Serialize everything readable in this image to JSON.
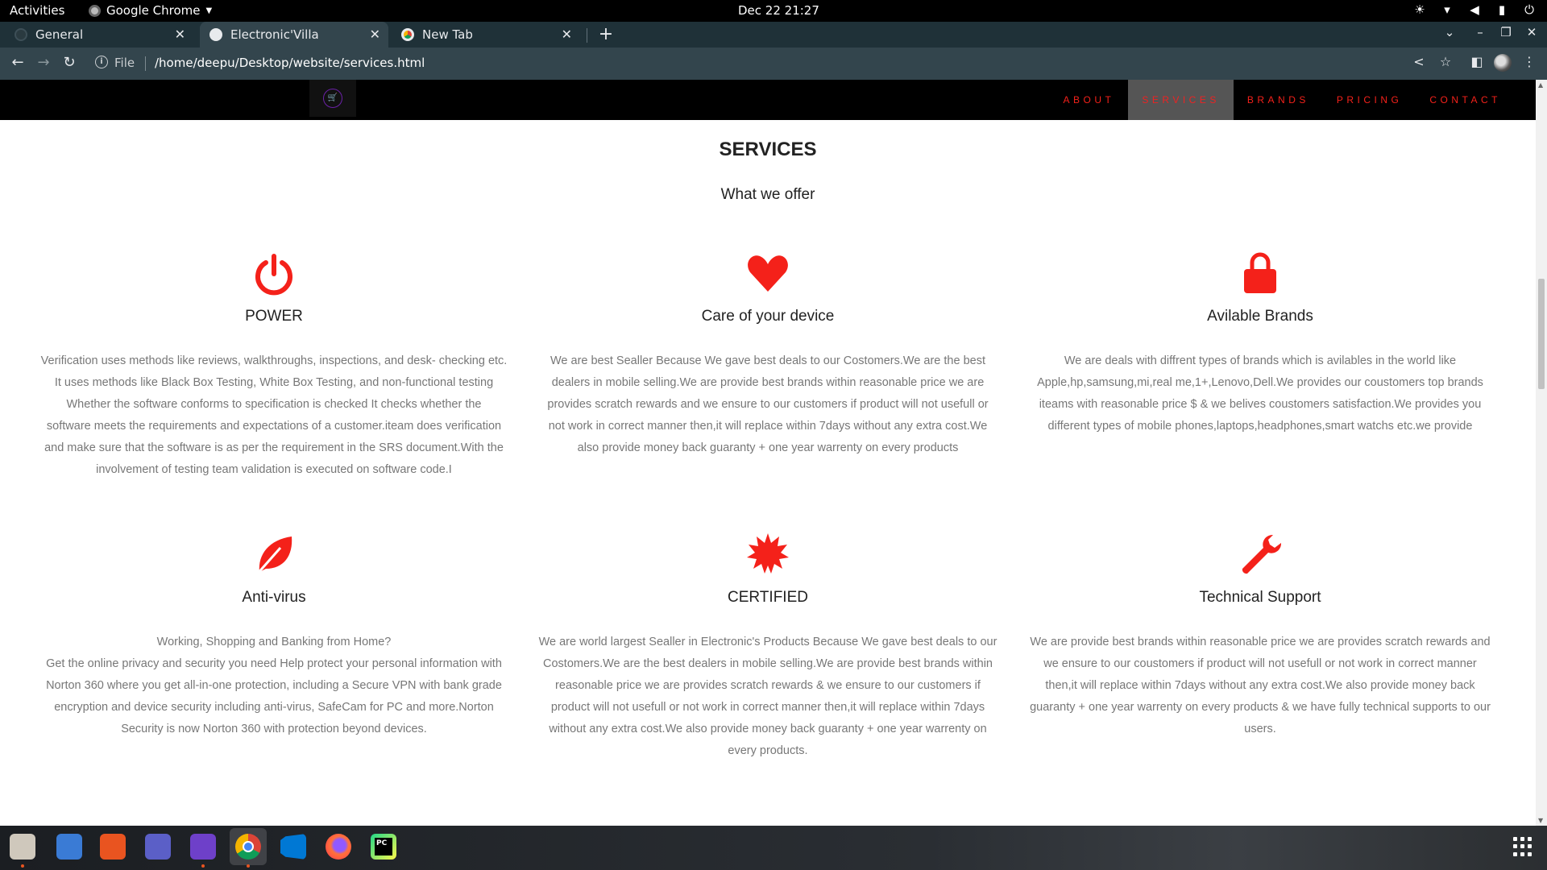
{
  "topbar": {
    "activities": "Activities",
    "app": "Google Chrome",
    "clock": "Dec 22  21:27"
  },
  "tabs": [
    {
      "label": "General",
      "active": false
    },
    {
      "label": "Electronic'Villa",
      "active": true
    },
    {
      "label": "New Tab",
      "active": false
    }
  ],
  "toolbar": {
    "scheme": "File",
    "url": "/home/deepu/Desktop/website/services.html"
  },
  "site": {
    "nav": [
      "ABOUT",
      "SERVICES",
      "BRANDS",
      "PRICING",
      "CONTACT"
    ],
    "active_nav": "SERVICES",
    "heading": "SERVICES",
    "subheading": "What we offer"
  },
  "services": [
    {
      "icon": "power-icon",
      "title": "POWER",
      "text": "Verification uses methods like reviews, walkthroughs, inspections, and desk- checking etc.\nIt uses methods like Black Box Testing, White Box Testing, and non-functional testing\nWhether the software conforms to specification is checked It checks whether the\nsoftware meets the requirements and expectations of a customer.iteam does verification\nand make sure that the software is as per the requirement in the SRS document.With the\ninvolvement of testing team validation is executed on software code.I"
    },
    {
      "icon": "heart-icon",
      "title": "Care of your device",
      "text": "We are best Sealler Because We gave best deals to our Costomers.We are the best\ndealers in mobile selling.We are provide best brands within reasonable price we are\nprovides scratch rewards and we ensure to our customers if product will not usefull or\nnot work in correct manner then,it will replace within 7days without any extra cost.We\nalso provide money back guaranty + one year warrenty on every products"
    },
    {
      "icon": "lock-icon",
      "title": "Avilable Brands",
      "text": "We are deals with diffrent types of brands which is avilables in the world like\nApple,hp,samsung,mi,real me,1+,Lenovo,Dell.We provides our coustomers top brands\niteams with reasonable price $ & we belives coustomers satisfaction.We provides you\ndifferent types of mobile phones,laptops,headphones,smart watchs etc.we provide"
    },
    {
      "icon": "leaf-icon",
      "title": "Anti-virus",
      "text": "Working, Shopping and Banking from Home?\nGet the online privacy and security you need Help protect your personal information with\nNorton 360 where you get all-in-one protection, including a Secure VPN with bank grade\nencryption and device security including anti-virus, SafeCam for PC and more.Norton\nSecurity is now Norton 360 with protection beyond devices."
    },
    {
      "icon": "certificate-icon",
      "title": "CERTIFIED",
      "text": "We are world largest Sealler in Electronic's Products Because We gave best deals to our\nCostomers.We are the best dealers in mobile selling.We are provide best brands within\nreasonable price we are provides scratch rewards & we ensure to our customers if\nproduct will not usefull or not work in correct manner then,it will replace within 7days\nwithout any extra cost.We also provide money back guaranty + one year warrenty on\nevery products."
    },
    {
      "icon": "wrench-icon",
      "title": "Technical Support",
      "text": "We are provide best brands within reasonable price we are provides scratch rewards and\nwe ensure to our coustomers if product will not usefull or not work in correct manner\nthen,it will replace within 7days without any extra cost.We also provide money back\nguaranty + one year warrenty on every products & we have fully technical supports to our\nusers."
    }
  ],
  "colors": {
    "accent": "#f4211a",
    "nav_bg": "#000000",
    "active_nav_bg": "#555555",
    "text_muted": "#777777"
  },
  "dock": [
    "files-icon",
    "text-editor-icon",
    "software-center-icon",
    "teams-icon",
    "github-desktop-icon",
    "chrome-icon",
    "vscode-icon",
    "firefox-icon",
    "pycharm-icon"
  ]
}
